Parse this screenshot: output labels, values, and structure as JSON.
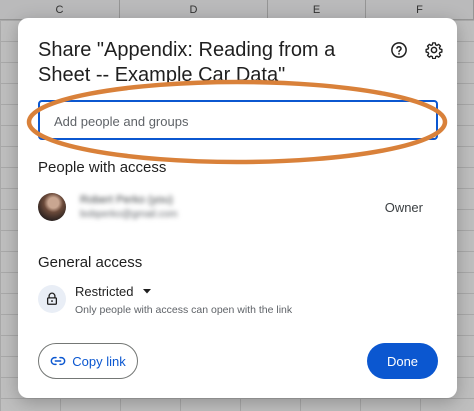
{
  "spreadsheet": {
    "columns": [
      "C",
      "D",
      "E",
      "F"
    ]
  },
  "dialog": {
    "title": "Share \"Appendix: Reading from a Sheet -- Example Car Data\"",
    "help_icon": "help-circle-icon",
    "settings_icon": "gear-icon",
    "search": {
      "placeholder": "Add people and groups",
      "value": ""
    },
    "annotation_color": "#d9813a",
    "people_section": {
      "title": "People with access",
      "people": [
        {
          "name": "Robert Perko (you)",
          "email": "bobperko@gmail.com",
          "role": "Owner"
        }
      ]
    },
    "general_access": {
      "title": "General access",
      "lock_icon": "lock-icon",
      "selected": "Restricted",
      "description": "Only people with access can open with the link"
    },
    "footer": {
      "copy_link_label": "Copy link",
      "copy_link_icon": "link-icon",
      "done_label": "Done"
    },
    "colors": {
      "primary": "#0b57d0",
      "annotation": "#d9813a"
    }
  }
}
